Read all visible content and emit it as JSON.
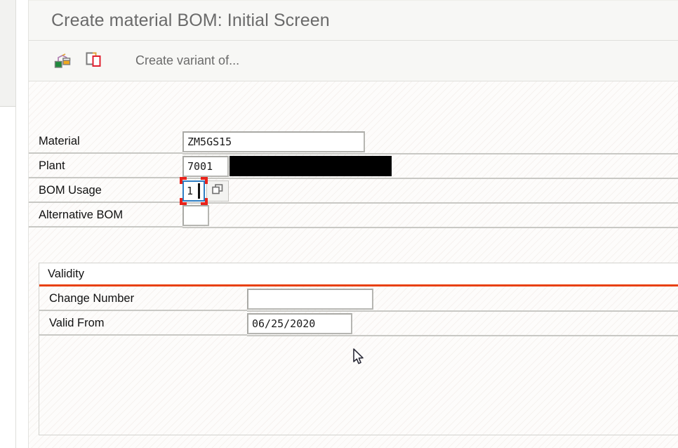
{
  "window": {
    "title": "Create material BOM: Initial Screen"
  },
  "toolbar": {
    "items": [
      {
        "name": "bom-structure-icon",
        "tooltip": "Display BOM structure"
      },
      {
        "name": "copy-icon",
        "tooltip": "Copy"
      }
    ],
    "create_variant_label": "Create variant of..."
  },
  "form": {
    "fields": [
      {
        "label": "Material",
        "value": "ZM5GS15",
        "placeholder": ""
      },
      {
        "label": "Plant",
        "value": "7001",
        "placeholder": "",
        "redacted_description": true
      },
      {
        "label": "BOM Usage",
        "value": "1",
        "placeholder": "",
        "focused": true,
        "highlighted": true,
        "has_search_help": true
      },
      {
        "label": "Alternative BOM",
        "value": "",
        "placeholder": ""
      }
    ]
  },
  "validity": {
    "title": "Validity",
    "fields": [
      {
        "label": "Change Number",
        "value": "",
        "placeholder": ""
      },
      {
        "label": "Valid From",
        "value": "06/25/2020",
        "placeholder": ""
      }
    ]
  },
  "colors": {
    "accent_orange": "#e8400c",
    "highlight_red": "#e8231c",
    "focus_blue": "#2f7fc4",
    "title_gray": "#6a6a6a",
    "canvas": "#fdfcfb"
  }
}
